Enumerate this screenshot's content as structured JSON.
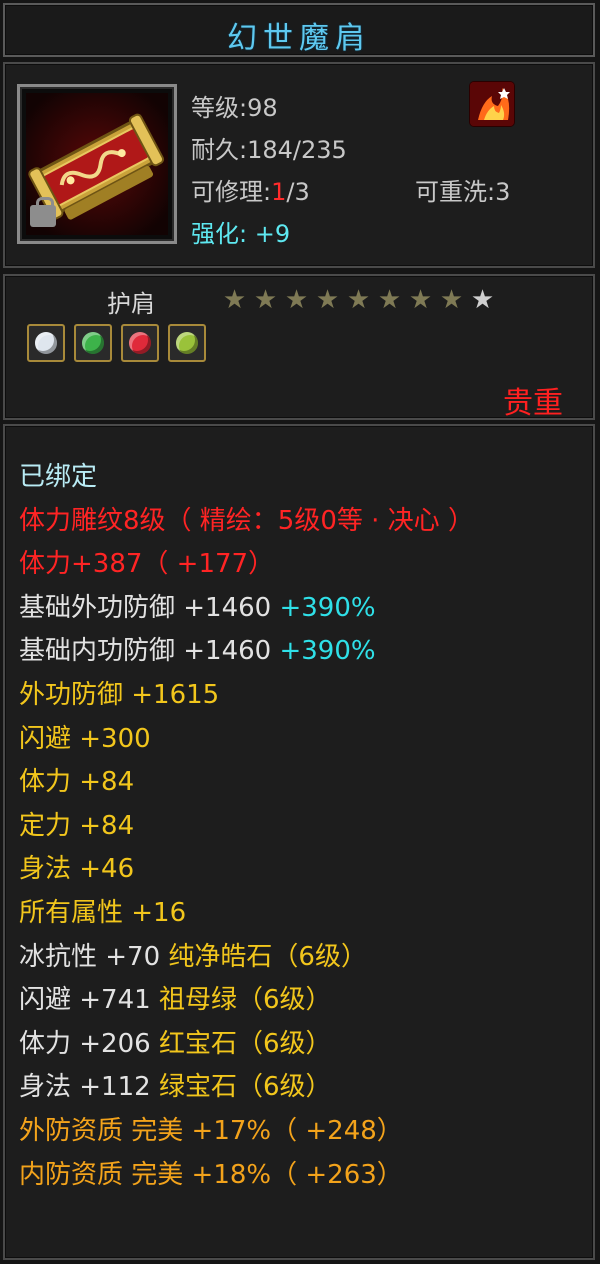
{
  "item": {
    "name": "幻世魔肩",
    "icon": "golden-pauldron-icon",
    "level_line": "等级:98",
    "durability_line": "耐久:184/235",
    "repair_label": "可修理:",
    "repair_used": "1",
    "repair_total": "/3",
    "rewash_line": "可重洗:3",
    "enhance_label": "强化:",
    "enhance_value": "+9",
    "school_icon": "fire-school-icon",
    "slot": "护肩",
    "stars": {
      "lit": 8,
      "total": 9
    },
    "gems": [
      {
        "icon": "white-diamond-gem-icon",
        "color": "#dfe6ee"
      },
      {
        "icon": "green-emerald-gem-icon",
        "color": "#3db34a"
      },
      {
        "icon": "red-ruby-gem-icon",
        "color": "#e02a3a"
      },
      {
        "icon": "green-peridot-gem-icon",
        "color": "#9ac23a"
      }
    ],
    "rarity": "贵重"
  },
  "stats": [
    {
      "text": "已绑定"
    },
    {
      "text": "体力雕纹8级（ 精绘：5级0等 · 决心 ）"
    },
    {
      "text": "体力+387（ +177）"
    },
    {
      "label": "基础外功防御  +1460 ",
      "extra": "+390%"
    },
    {
      "label": "基础内功防御  +1460 ",
      "extra": "+390%"
    },
    {
      "text": "外功防御  +1615"
    },
    {
      "text": "闪避  +300"
    },
    {
      "text": "体力  +84"
    },
    {
      "text": "定力  +84"
    },
    {
      "text": "身法  +46"
    },
    {
      "text": "所有属性  +16"
    },
    {
      "label": "冰抗性  +70 ",
      "extra": "纯净皓石（6级）"
    },
    {
      "label": "闪避  +741 ",
      "extra": "祖母绿（6级）"
    },
    {
      "label": "体力  +206 ",
      "extra": "红宝石（6级）"
    },
    {
      "label": "身法  +112 ",
      "extra": "绿宝石（6级）"
    },
    {
      "text": "外防资质   完美  +17%（ +248）"
    },
    {
      "text": "内防资质   完美  +18%（ +263）"
    }
  ],
  "colors": {
    "title": "#5ec9f0",
    "bound": "#b9ecf5",
    "engraving": "#ff2424",
    "base_stat": "#e2e2e2",
    "bonus_stat": "#f2c61c",
    "percent": "#2fe0e8",
    "aptitude": "#f3a31b",
    "rarity": "#ff2020"
  }
}
